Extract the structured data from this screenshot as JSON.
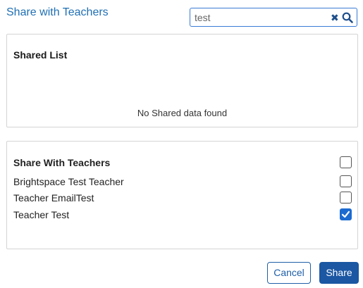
{
  "dialog": {
    "title": "Share with Teachers"
  },
  "search": {
    "value": "test",
    "clear_icon": "close-icon",
    "search_icon": "magnifier-icon"
  },
  "shared_list": {
    "heading": "Shared List",
    "empty_message": "No Shared data found"
  },
  "share_with": {
    "heading": "Share With Teachers",
    "select_all_checked": false,
    "teachers": [
      {
        "name": "Brightspace Test Teacher",
        "checked": false
      },
      {
        "name": "Teacher EmailTest",
        "checked": false
      },
      {
        "name": "Teacher Test",
        "checked": true
      }
    ]
  },
  "buttons": {
    "cancel_label": "Cancel",
    "share_label": "Share"
  },
  "colors": {
    "accent": "#1f6fb4",
    "primary_button": "#1b57a3",
    "checkbox_checked": "#1b6ad0"
  }
}
